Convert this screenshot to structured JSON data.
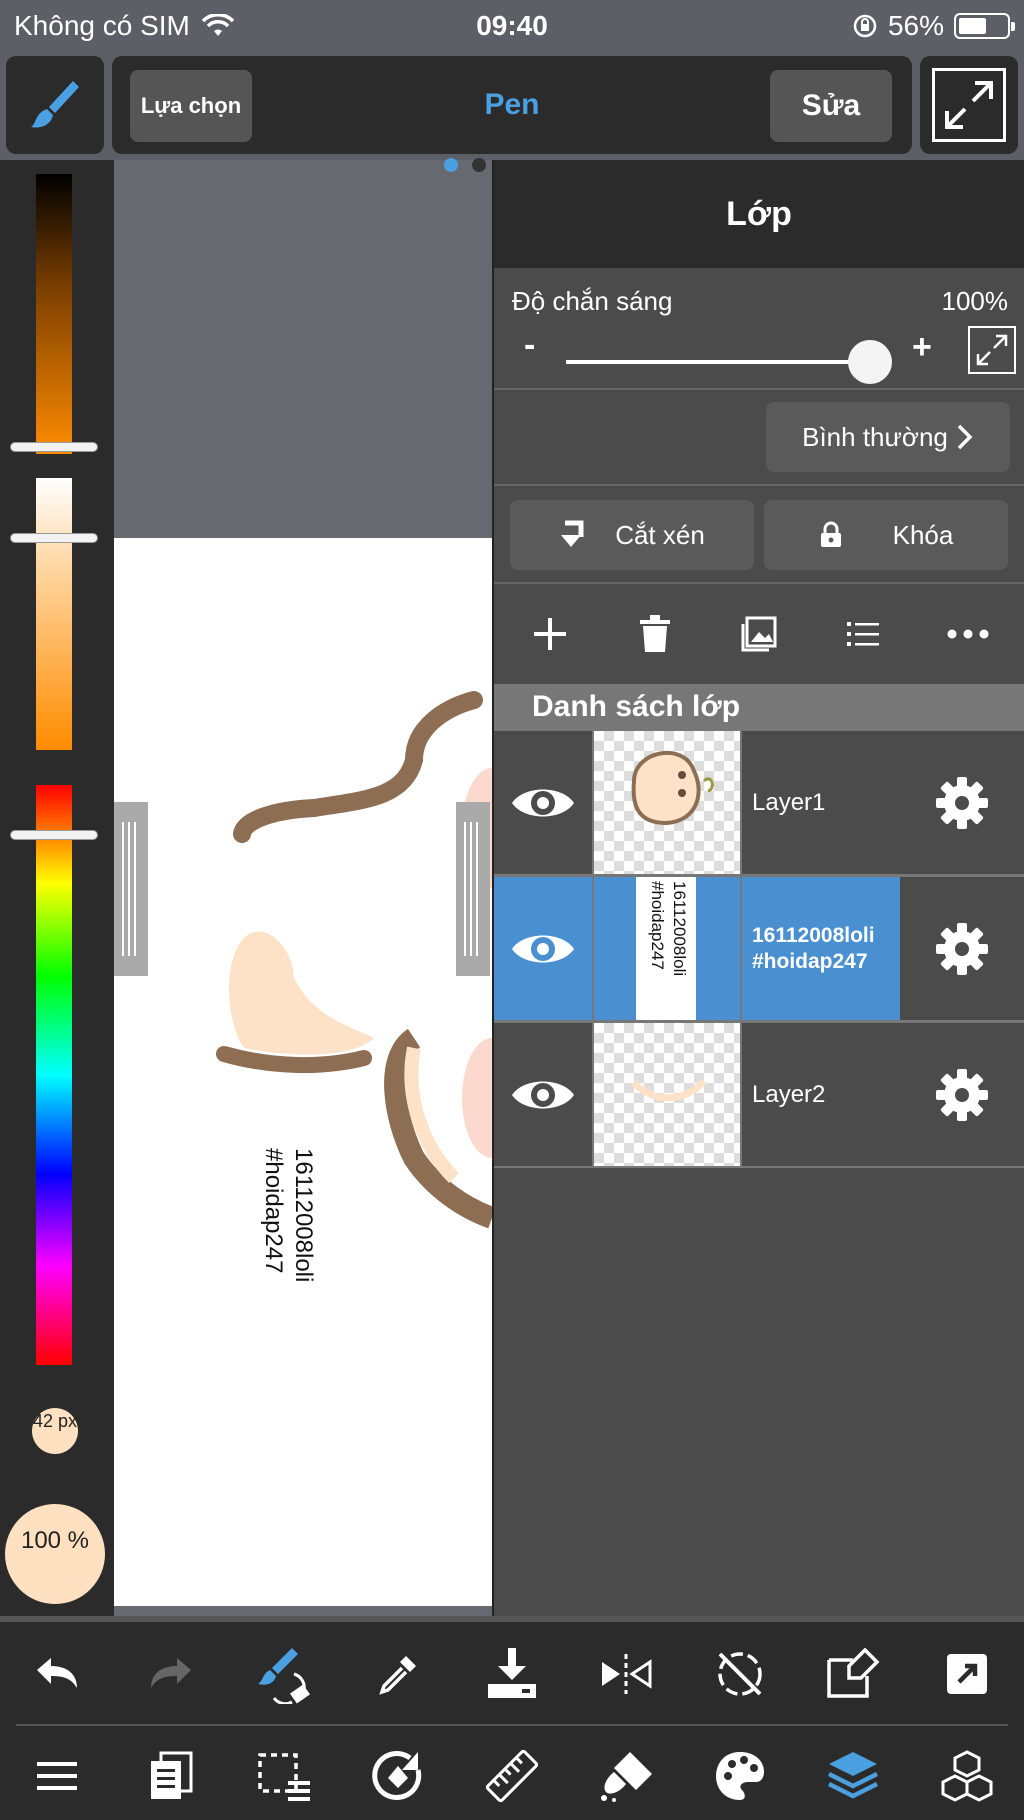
{
  "status_bar": {
    "carrier": "Không có SIM",
    "time": "09:40",
    "battery": "56%",
    "battery_level": 0.56
  },
  "toolbar": {
    "select_label": "Lựa chọn",
    "tool_name": "Pen",
    "edit_label": "Sửa"
  },
  "color_bar": {
    "brush_size": "42 px",
    "brush_opacity": "100 %"
  },
  "canvas": {
    "rotated_text": "16112008loli #hoidap247"
  },
  "layer_panel": {
    "title": "Lớp",
    "opacity_label": "Độ chắn sáng",
    "opacity_value": "100%",
    "opacity_level": 1.0,
    "minus": "-",
    "plus": "+",
    "blend_mode": "Bình thường",
    "clip_label": "Cắt xén",
    "lock_label": "Khóa",
    "list_header": "Danh sách lớp",
    "layers": [
      {
        "name": "Layer1",
        "active": false
      },
      {
        "name": "16112008loli #hoidap247",
        "active": true
      },
      {
        "name": "Layer2",
        "active": false
      }
    ]
  },
  "colors": {
    "accent": "#4a90d0",
    "tool_name": "#4aa0e0",
    "panel": "#4b4b4b",
    "dark": "#2b2b2b"
  }
}
